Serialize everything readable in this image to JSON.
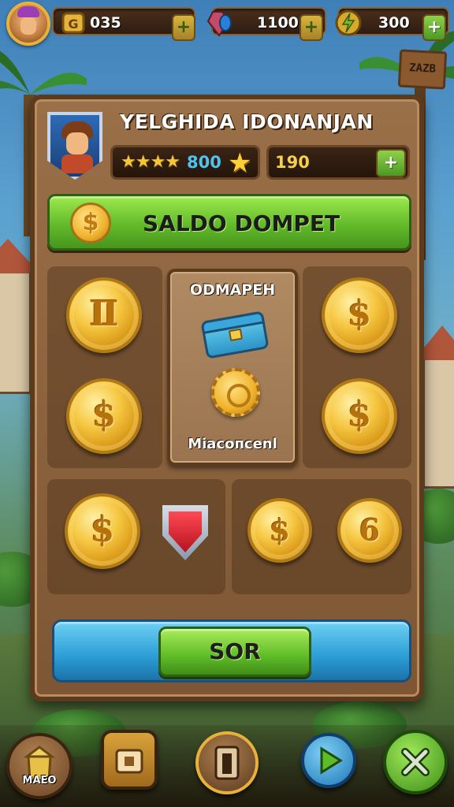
{
  "topbar": {
    "coins_value": "035",
    "gems_value": "1100",
    "energy_value": "300",
    "plus_symbol": "+"
  },
  "sign_text": "ZAZB",
  "panel": {
    "player_name": "YELGHIDA IDONANJAN",
    "rating_stars": "★★★★",
    "rating_value": "800",
    "secondary_value": "190",
    "balance_label": "SALDO DOMPET",
    "balance_coin_symbol": "$"
  },
  "coins": [
    {
      "symbol": "Ⅱ"
    },
    {
      "symbol": "$"
    },
    {
      "symbol": "$"
    },
    {
      "symbol": "$"
    },
    {
      "symbol": "$"
    },
    {
      "symbol": "$"
    },
    {
      "symbol": "6"
    }
  ],
  "shop_card": {
    "title": "ODMAPEH",
    "subtitle": "Miacoпcenl"
  },
  "action_button": "SOR",
  "bottom_nav": {
    "first_label": "MAEO"
  },
  "colors": {
    "gold": "#f6c742",
    "green_primary": "#62bb2a",
    "blue_bar": "#2c9dd6",
    "panel_wood": "#8a6240"
  },
  "icons": [
    "coin-icon",
    "gem-icon",
    "energy-icon",
    "star-icon",
    "shield-icon",
    "chest-icon",
    "gear-icon",
    "home-icon",
    "shop-icon",
    "door-icon",
    "play-icon",
    "close-icon"
  ]
}
